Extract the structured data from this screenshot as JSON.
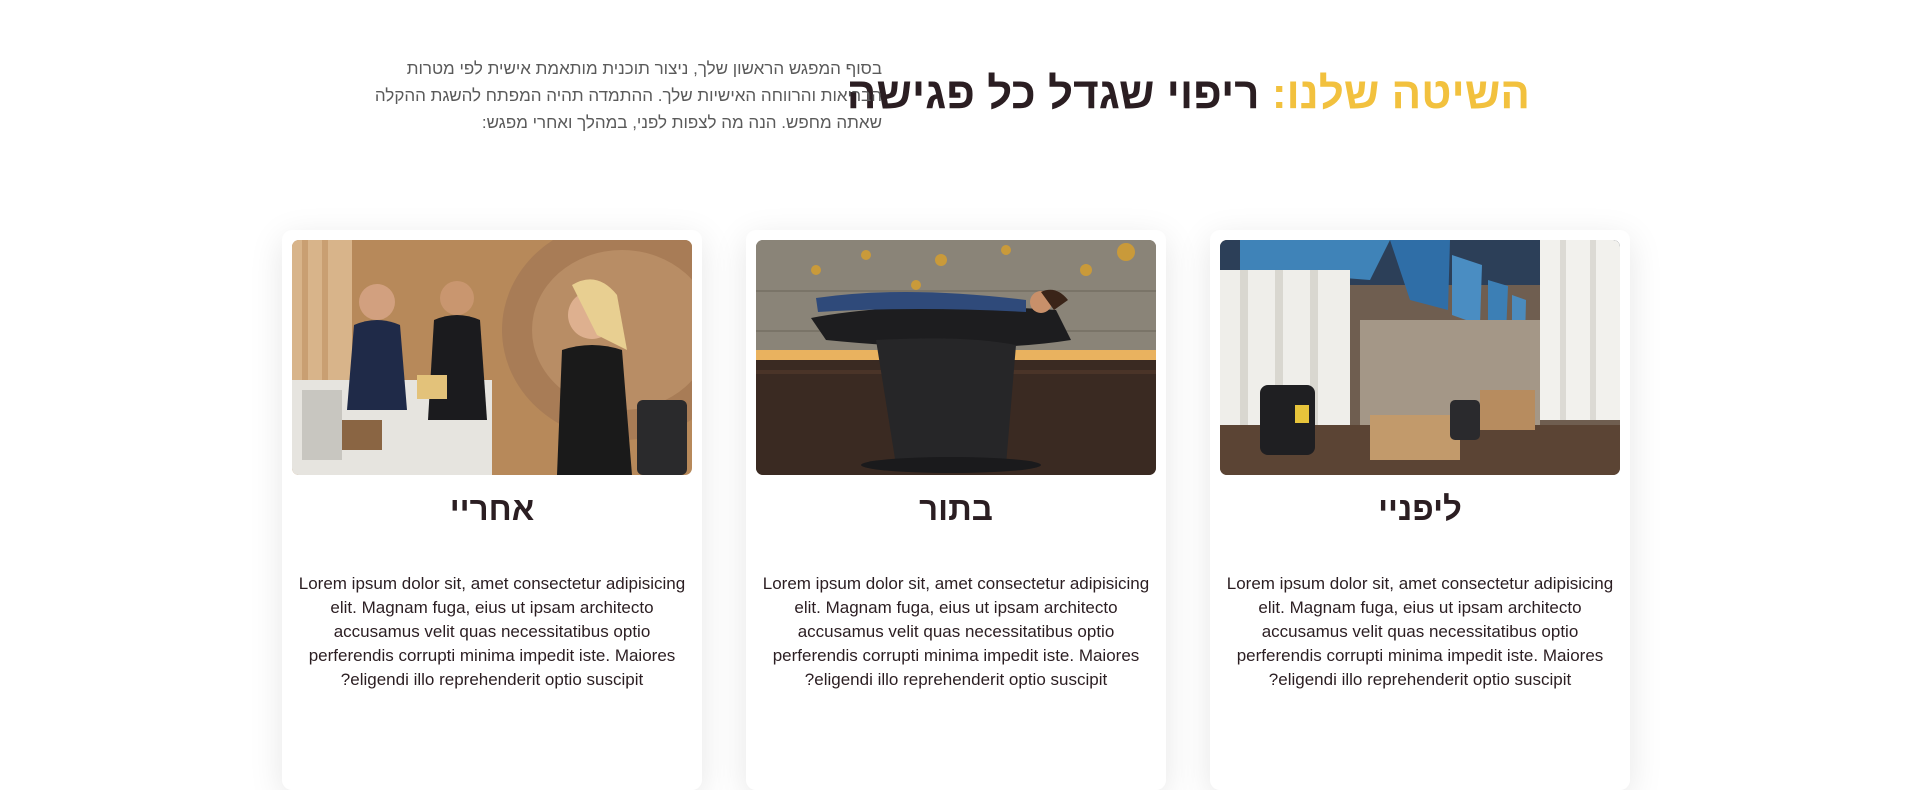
{
  "header": {
    "title_accent": "השיטה שלנו:",
    "title_main": "ריפוי שגדל כל פגישה",
    "intro": "בסוף המפגש הראשון שלך, ניצור תוכנית מותאמת אישית לפי מטרות הבריאות והרווחה האישיות שלך. ההתמדה תהיה המפתח להשגת ההקלה שאתה מחפש. הנה מה לצפות לפני, במהלך ואחרי מפגש:"
  },
  "cards": [
    {
      "title": "ליפניי",
      "body": "Lorem ipsum dolor sit, amet consectetur adipisicing elit. Magnam fuga, eius ut ipsam architecto accusamus velit quas necessitatibus optio perferendis corrupti minima impedit iste. Maiores eligendi illo reprehenderit optio suscipit?",
      "image": "spa-lounge-image"
    },
    {
      "title": "בתור",
      "body": "Lorem ipsum dolor sit, amet consectetur adipisicing elit. Magnam fuga, eius ut ipsam architecto accusamus velit quas necessitatibus optio perferendis corrupti minima impedit iste. Maiores eligendi illo reprehenderit optio suscipit?",
      "image": "massage-chair-image"
    },
    {
      "title": "אחריי",
      "body": "Lorem ipsum dolor sit, amet consectetur adipisicing elit. Magnam fuga, eius ut ipsam architecto accusamus velit quas necessitatibus optio perferendis corrupti minima impedit iste. Maiores eligendi illo reprehenderit optio suscipit?",
      "image": "consultation-image"
    }
  ],
  "colors": {
    "accent": "#f2c13e",
    "text_dark": "#2b1e22",
    "text_muted": "#5a5a5a",
    "background": "#ffffff"
  }
}
